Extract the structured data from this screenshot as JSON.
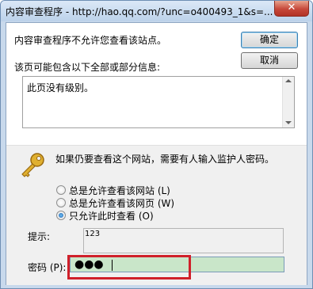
{
  "window": {
    "title": "内容审查程序 - http://hao.qq.com/?unc=o400493_1&s=...",
    "close_symbol": "✕"
  },
  "message": {
    "blocked": "内容审查程序不允许您查看该站点。",
    "info_label": "该页可能包含以下全部或部分信息:",
    "info_text": "此页没有级别。"
  },
  "buttons": {
    "ok": "确定",
    "cancel": "取消"
  },
  "prompt": {
    "key_icon": "key-icon",
    "text": "如果仍要查看这个网站，需要有人输入监护人密码。"
  },
  "options": [
    {
      "label": "总是允许查看该网站 (L)",
      "checked": false
    },
    {
      "label": "总是允许查看该网页 (W)",
      "checked": false
    },
    {
      "label": "只允许此时查看 (O)",
      "checked": true
    }
  ],
  "hint": {
    "label": "提示:",
    "value": "123"
  },
  "password": {
    "label": "密码 (P):",
    "masked_value": "●●●"
  },
  "colors": {
    "highlight_box": "#d0202a",
    "password_field_bg": "#c9e6c9"
  }
}
